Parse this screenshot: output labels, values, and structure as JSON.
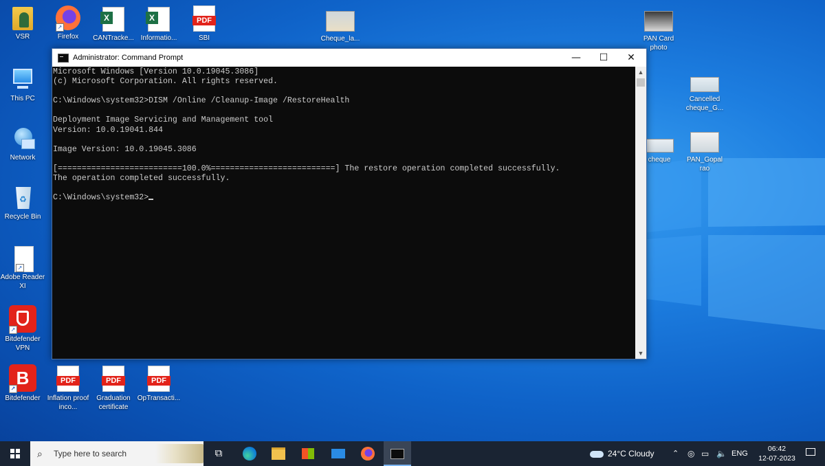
{
  "desktop": {
    "icons": [
      {
        "label": "VSR",
        "kind": "user-folder"
      },
      {
        "label": "Firefox",
        "kind": "firefox"
      },
      {
        "label": "CANTracke...",
        "kind": "excel"
      },
      {
        "label": "Informatio...",
        "kind": "excel"
      },
      {
        "label": "SBI",
        "kind": "pdf"
      },
      {
        "label": "Cheque_la...",
        "kind": "image"
      },
      {
        "label": "PAN Card photo",
        "kind": "image"
      },
      {
        "label": "This PC",
        "kind": "pc"
      },
      {
        "label": "Cancelled cheque_G...",
        "kind": "image"
      },
      {
        "label": "Network",
        "kind": "network"
      },
      {
        "label": "cheque",
        "kind": "image"
      },
      {
        "label": "PAN_Gopal rao",
        "kind": "image"
      },
      {
        "label": "Recycle Bin",
        "kind": "recycle"
      },
      {
        "label": "Adobe Reader XI",
        "kind": "file"
      },
      {
        "label": "Bitdefender VPN",
        "kind": "bitdefender-vpn"
      },
      {
        "label": "Bitdefender",
        "kind": "bitdefender"
      },
      {
        "label": "Inflation proof inco...",
        "kind": "pdf"
      },
      {
        "label": "Graduation certificate",
        "kind": "pdf"
      },
      {
        "label": "OpTransacti...",
        "kind": "pdf"
      }
    ],
    "pdf_tag": "PDF",
    "excel_tag": "X"
  },
  "cmd": {
    "title": "Administrator: Command Prompt",
    "lines": [
      "Microsoft Windows [Version 10.0.19045.3086]",
      "(c) Microsoft Corporation. All rights reserved.",
      "",
      "C:\\Windows\\system32>DISM /Online /Cleanup-Image /RestoreHealth",
      "",
      "Deployment Image Servicing and Management tool",
      "Version: 10.0.19041.844",
      "",
      "Image Version: 10.0.19045.3086",
      "",
      "[==========================100.0%==========================] The restore operation completed successfully.",
      "The operation completed successfully.",
      "",
      "C:\\Windows\\system32>"
    ],
    "controls": {
      "minimize": "—",
      "maximize": "☐",
      "close": "✕"
    }
  },
  "taskbar": {
    "search_placeholder": "Type here to search",
    "weather": "24°C  Cloudy",
    "language": "ENG",
    "time": "06:42",
    "date": "12-07-2023",
    "pinned": [
      "task-view",
      "edge",
      "file-explorer",
      "store",
      "mail",
      "firefox",
      "command-prompt"
    ]
  },
  "colors": {
    "desktop_blue": "#0f63c9",
    "taskbar": "#1a2433",
    "console_bg": "#0c0c0c",
    "console_text": "#cccccc",
    "pdf_red": "#e2231a",
    "excel_green": "#1d7045"
  }
}
